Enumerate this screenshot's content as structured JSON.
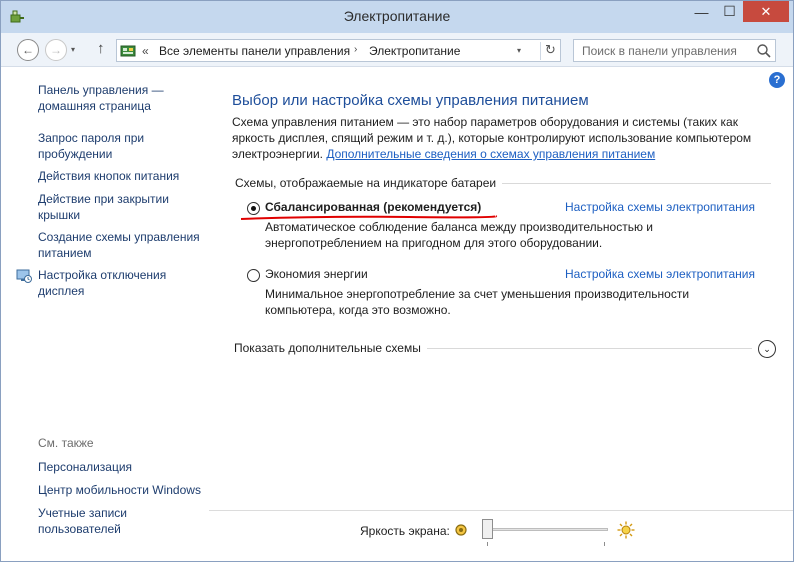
{
  "window": {
    "title": "Электропитание",
    "controls": {
      "minimize": "—",
      "maximize": "☐",
      "close": "✕"
    }
  },
  "navbar": {
    "back": "←",
    "forward": "→",
    "recent": "▾",
    "up": "↑",
    "address_chevron": "«",
    "breadcrumbs": [
      "Все элементы панели управления",
      "Электропитание"
    ],
    "breadcrumb_separator": "›",
    "address_dropdown": "▾",
    "refresh": "↻",
    "search_placeholder": "Поиск в панели управления"
  },
  "help": {
    "label": "?"
  },
  "sidebar": {
    "home": "Панель управления — домашняя страница",
    "items": [
      "Запрос пароля при пробуждении",
      "Действия кнопок питания",
      "Действие при закрытии крышки",
      "Создание схемы управления питанием",
      "Настройка отключения дисплея"
    ],
    "see_also_title": "См. также",
    "see_also": [
      "Персонализация",
      "Центр мобильности Windows",
      "Учетные записи пользователей"
    ]
  },
  "main": {
    "title": "Выбор или настройка схемы управления питанием",
    "intro_text": "Схема управления питанием — это набор параметров оборудования и системы (таких как яркость дисплея, спящий режим и т. д.), которые контролируют использование компьютером электроэнергии. ",
    "intro_link": "Дополнительные сведения о схемах управления питанием",
    "group_label": "Схемы, отображаемые на индикаторе батареи",
    "plans": [
      {
        "name": "Сбалансированная (рекомендуется)",
        "description": "Автоматическое соблюдение баланса между производительностью и энергопотреблением на пригодном для этого оборудовании.",
        "link": "Настройка схемы электропитания",
        "selected": true
      },
      {
        "name": "Экономия энергии",
        "description": "Минимальное энергопотребление за счет уменьшения производительности компьютера, когда это возможно.",
        "link": "Настройка схемы электропитания",
        "selected": false
      }
    ],
    "more_plans": "Показать дополнительные схемы",
    "more_toggle": "⌄"
  },
  "brightness": {
    "label": "Яркость экрана:",
    "level": 0
  },
  "colors": {
    "title_bar": "#c5d8ee",
    "link": "#1d5fc2",
    "heading": "#1e4e9a",
    "annotation_red": "#e00000",
    "close_button": "#c74a3e"
  }
}
